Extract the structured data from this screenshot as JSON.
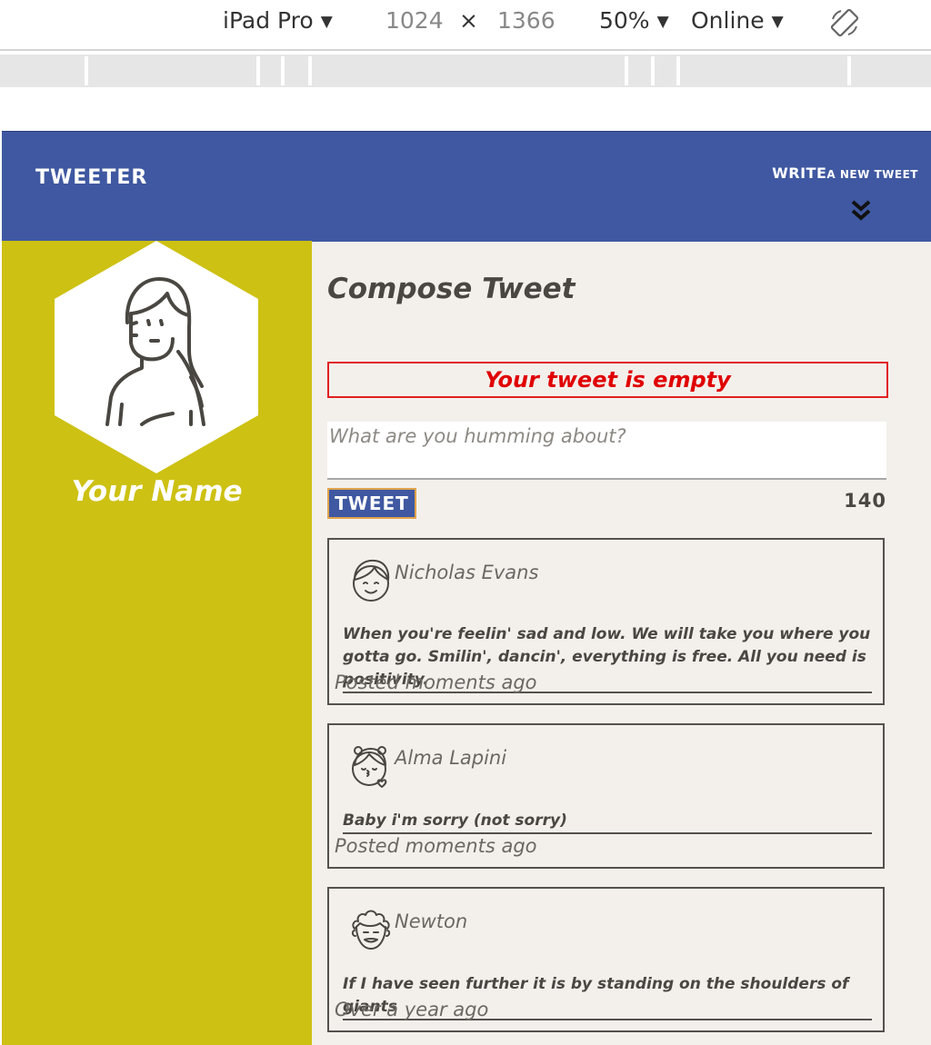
{
  "devtools": {
    "device": "iPad Pro",
    "width": "1024",
    "times": "×",
    "height": "1366",
    "zoom": "50%",
    "network": "Online",
    "caret": "▼",
    "rotate_icon": "rotate-icon"
  },
  "app": {
    "brand": "TWEETER",
    "write_big": "WRITE",
    "write_small": "A NEW TWEET",
    "chevron_icon": "double-chevron-down-icon",
    "colors": {
      "nav": "#3f58a1",
      "sidebar": "#cdc113",
      "background": "#f3f0ec",
      "error": "#e00000",
      "button_border": "#e0a44c"
    }
  },
  "profile": {
    "avatar_icon": "female-user-avatar-icon",
    "name": "Your Name"
  },
  "compose": {
    "title": "Compose Tweet",
    "error": "Your tweet is empty",
    "placeholder": "What are you humming about?",
    "button": "TWEET",
    "counter": "140"
  },
  "tweets": [
    {
      "author": "Nicholas Evans",
      "avatar_icon": "boy-avatar-icon",
      "text": "When you're feelin' sad and low. We will take you where you gotta go. Smilin', dancin', everything is free. All you need is positivity.",
      "time": "Posted moments ago"
    },
    {
      "author": "Alma Lapini",
      "avatar_icon": "girl-kiss-avatar-icon",
      "text": "Baby i'm sorry (not sorry)",
      "time": "Posted moments ago"
    },
    {
      "author": "Newton",
      "avatar_icon": "curly-hair-man-avatar-icon",
      "text": "If I have seen further it is by standing on the shoulders of giants",
      "time": "Over a year ago"
    }
  ]
}
